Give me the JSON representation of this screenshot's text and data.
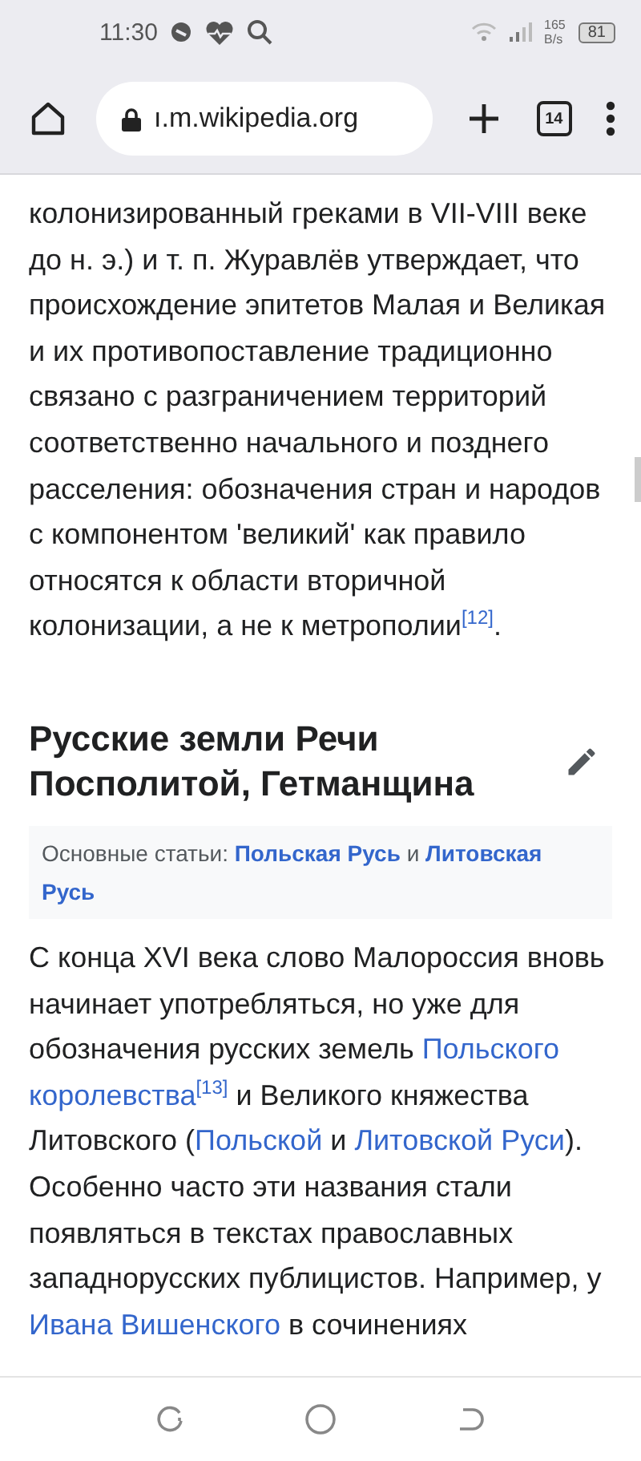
{
  "status_bar": {
    "time": "11:30",
    "net_speed": "165",
    "net_unit": "B/s",
    "battery": "81"
  },
  "toolbar": {
    "url": "ı.m.wikipedia.org",
    "tab_count": "14"
  },
  "intro_paragraph": [
    {
      "kind": "text",
      "text": "колонизированный греками в VII-VIII веке до н. э.) и т. п. Журавлёв утверждает, что происхождение эпитетов Малая и Великая и их противопоставление традиционно связано с разграничением территорий соответственно начального и позднего расселения: обозначения стран и народов с компонентом 'великий' как правило относятся к области вторичной колонизации, а не к метрополии"
    },
    {
      "kind": "ref",
      "text": "[12]"
    },
    {
      "kind": "text",
      "text": "."
    }
  ],
  "section": {
    "heading": "Русские земли Речи Посполитой, Гетманщина"
  },
  "hatnote": [
    {
      "kind": "text",
      "text": "Основные статьи: "
    },
    {
      "kind": "link",
      "text": "Польская Русь"
    },
    {
      "kind": "text",
      "text": " и "
    },
    {
      "kind": "link",
      "text": "Литовская"
    },
    {
      "kind": "link",
      "text": "Русь"
    }
  ],
  "body_paragraph": [
    {
      "kind": "text",
      "text": "С конца XVI века слово Малороссия вновь начинает употребляться, но уже для обозначения русских земель "
    },
    {
      "kind": "link",
      "text": "Польского"
    },
    {
      "kind": "link",
      "text": "королевства"
    },
    {
      "kind": "ref",
      "text": "[13]"
    },
    {
      "kind": "text",
      "text": " и Великого княжества Литовского ("
    },
    {
      "kind": "link",
      "text": "Польской"
    },
    {
      "kind": "text",
      "text": " и "
    },
    {
      "kind": "link",
      "text": "Литовской Руси"
    },
    {
      "kind": "text",
      "text": "). Особенно часто эти названия стали появляться в текстах православных западнорусских публицистов. Например, у "
    },
    {
      "kind": "link",
      "text": "Ивана Вишенского"
    },
    {
      "kind": "text",
      "text": " в сочинениях"
    }
  ]
}
